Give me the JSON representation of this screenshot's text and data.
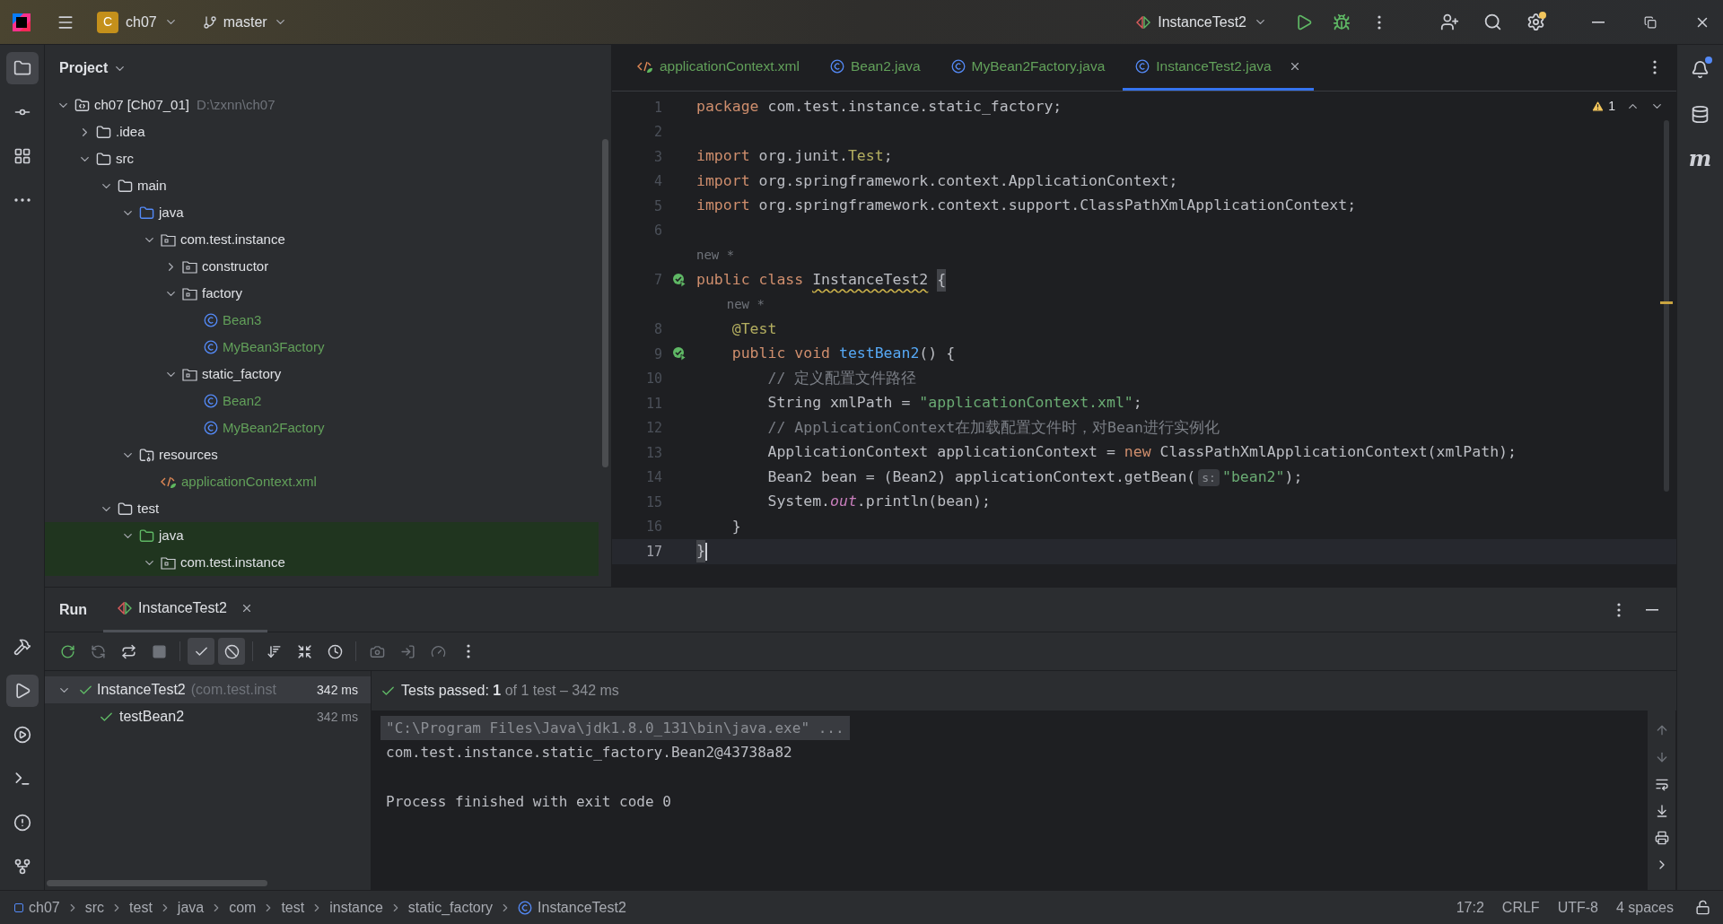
{
  "title_bar": {
    "project_badge": "C",
    "project": "ch07",
    "branch": "master",
    "run_config": "InstanceTest2",
    "settings_badge": true
  },
  "left_toolbar": {
    "top": [
      {
        "kind": "project",
        "selected": true
      },
      {
        "kind": "commit",
        "selected": false
      },
      {
        "kind": "structure",
        "selected": false
      },
      {
        "kind": "more",
        "selected": false
      }
    ],
    "bottom": [
      {
        "kind": "build",
        "selected": false
      },
      {
        "kind": "run",
        "selected": true
      },
      {
        "kind": "services",
        "selected": false
      },
      {
        "kind": "terminal",
        "selected": false
      },
      {
        "kind": "problems",
        "selected": false
      },
      {
        "kind": "git",
        "selected": false
      }
    ]
  },
  "right_toolbar": [
    {
      "kind": "notifications",
      "badge": true
    },
    {
      "kind": "database",
      "badge": false
    },
    {
      "kind": "maven",
      "label": "m",
      "badge": false
    }
  ],
  "project": {
    "title": "Project",
    "tree": [
      {
        "label": "ch07 [Ch07_01]",
        "path": "D:\\zxnn\\ch07",
        "kind": "module",
        "expanded": true,
        "test_scope": false,
        "children": [
          {
            "label": ".idea",
            "kind": "folder",
            "expanded": false,
            "test_scope": false
          },
          {
            "label": "src",
            "kind": "folder",
            "expanded": true,
            "test_scope": false,
            "children": [
              {
                "label": "main",
                "kind": "folder",
                "expanded": true,
                "test_scope": false,
                "children": [
                  {
                    "label": "java",
                    "kind": "source_root",
                    "expanded": true,
                    "test_scope": false,
                    "children": [
                      {
                        "label": "com.test.instance",
                        "kind": "package",
                        "expanded": true,
                        "test_scope": false,
                        "children": [
                          {
                            "label": "constructor",
                            "kind": "package",
                            "expanded": false,
                            "test_scope": false
                          },
                          {
                            "label": "factory",
                            "kind": "package",
                            "expanded": true,
                            "test_scope": false,
                            "children": [
                              {
                                "label": "Bean3",
                                "kind": "class",
                                "test_scope": false
                              },
                              {
                                "label": "MyBean3Factory",
                                "kind": "class",
                                "test_scope": false
                              }
                            ]
                          },
                          {
                            "label": "static_factory",
                            "kind": "package",
                            "expanded": true,
                            "test_scope": false,
                            "children": [
                              {
                                "label": "Bean2",
                                "kind": "class",
                                "test_scope": false
                              },
                              {
                                "label": "MyBean2Factory",
                                "kind": "class",
                                "test_scope": false
                              }
                            ]
                          }
                        ]
                      }
                    ]
                  },
                  {
                    "label": "resources",
                    "kind": "resources",
                    "expanded": true,
                    "test_scope": false,
                    "children": [
                      {
                        "label": "applicationContext.xml",
                        "kind": "xml",
                        "test_scope": false
                      }
                    ]
                  }
                ]
              },
              {
                "label": "test",
                "kind": "folder",
                "expanded": true,
                "test_scope": false,
                "children": [
                  {
                    "label": "java",
                    "kind": "test_root",
                    "expanded": true,
                    "test_scope": true,
                    "children": [
                      {
                        "label": "com.test.instance",
                        "kind": "package",
                        "expanded": true,
                        "test_scope": true
                      }
                    ]
                  }
                ]
              }
            ]
          }
        ]
      }
    ]
  },
  "editor": {
    "tabs": [
      {
        "label": "applicationContext.xml",
        "kind": "xml",
        "selected": false,
        "closable": false
      },
      {
        "label": "Bean2.java",
        "kind": "class",
        "selected": false,
        "closable": false
      },
      {
        "label": "MyBean2Factory.java",
        "kind": "class",
        "selected": false,
        "closable": false
      },
      {
        "label": "InstanceTest2.java",
        "kind": "class",
        "selected": true,
        "closable": true
      }
    ],
    "warnings": "1",
    "lines": [
      {
        "kind": "code",
        "number": "1",
        "tokens": [
          {
            "kind": "keyword",
            "text": "package"
          },
          {
            "kind": "plain",
            "text": " com.test.instance.static_factory;"
          }
        ]
      },
      {
        "kind": "code",
        "number": "2"
      },
      {
        "kind": "code",
        "number": "3",
        "tokens": [
          {
            "kind": "keyword",
            "text": "import"
          },
          {
            "kind": "plain",
            "text": " org.junit."
          },
          {
            "kind": "annotation",
            "text": "Test"
          },
          {
            "kind": "plain",
            "text": ";"
          }
        ]
      },
      {
        "kind": "code",
        "number": "4",
        "tokens": [
          {
            "kind": "keyword",
            "text": "import"
          },
          {
            "kind": "plain",
            "text": " org.springframework.context.ApplicationContext;"
          }
        ]
      },
      {
        "kind": "code",
        "number": "5",
        "tokens": [
          {
            "kind": "keyword",
            "text": "import"
          },
          {
            "kind": "plain",
            "text": " org.springframework.context.support.ClassPathXmlApplicationContext;"
          }
        ]
      },
      {
        "kind": "code",
        "number": "6"
      },
      {
        "kind": "hint",
        "text": "new *"
      },
      {
        "kind": "code",
        "number": "7",
        "runnable": true,
        "tokens": [
          {
            "kind": "keyword",
            "text": "public class "
          },
          {
            "kind": "warn",
            "text": "InstanceTest2"
          },
          {
            "kind": "brace",
            "text": "{"
          }
        ]
      },
      {
        "kind": "hint",
        "text": "    new *"
      },
      {
        "kind": "code",
        "number": "8",
        "tokens": [
          {
            "kind": "annotation",
            "text": "    @Test"
          }
        ]
      },
      {
        "kind": "code",
        "number": "9",
        "runnable": true,
        "tokens": [
          {
            "kind": "keyword",
            "text": "    public void "
          },
          {
            "kind": "method",
            "text": "testBean2"
          },
          {
            "kind": "plain",
            "text": "() {"
          }
        ]
      },
      {
        "kind": "code",
        "number": "10",
        "tokens": [
          {
            "kind": "comment",
            "text": "        // 定义配置文件路径"
          }
        ]
      },
      {
        "kind": "code",
        "number": "11",
        "tokens": [
          {
            "kind": "plain",
            "text": "        String xmlPath = "
          },
          {
            "kind": "string",
            "text": "\"applicationContext.xml\""
          },
          {
            "kind": "plain",
            "text": ";"
          }
        ]
      },
      {
        "kind": "code",
        "number": "12",
        "tokens": [
          {
            "kind": "comment",
            "text": "        // ApplicationContext在加载配置文件时，对Bean进行实例化"
          }
        ]
      },
      {
        "kind": "code",
        "number": "13",
        "tokens": [
          {
            "kind": "plain",
            "text": "        ApplicationContext applicationContext = "
          },
          {
            "kind": "keyword",
            "text": "new"
          },
          {
            "kind": "plain",
            "text": " ClassPathXmlApplicationContext(xmlPath);"
          }
        ]
      },
      {
        "kind": "code",
        "number": "14",
        "tokens": [
          {
            "kind": "plain",
            "text": "        Bean2 bean = (Bean2) applicationContext.getBean("
          },
          {
            "kind": "inlay",
            "text": "s:"
          },
          {
            "kind": "string",
            "text": "\"bean2\""
          },
          {
            "kind": "plain",
            "text": ");"
          }
        ]
      },
      {
        "kind": "code",
        "number": "15",
        "tokens": [
          {
            "kind": "plain",
            "text": "        System."
          },
          {
            "kind": "static",
            "text": "out"
          },
          {
            "kind": "plain",
            "text": ".println(bean);"
          }
        ]
      },
      {
        "kind": "code",
        "number": "16",
        "tokens": [
          {
            "kind": "plain",
            "text": "    }"
          }
        ]
      },
      {
        "kind": "code",
        "number": "17",
        "current": true,
        "tokens": [
          {
            "kind": "brace",
            "text": "}"
          }
        ]
      }
    ]
  },
  "run": {
    "title": "Run",
    "tab": {
      "label": "InstanceTest2",
      "selected": true
    },
    "toolbar": [
      {
        "kind": "rerun",
        "enabled": true
      },
      {
        "kind": "rerun_failed",
        "enabled": false
      },
      {
        "kind": "toggle_auto",
        "enabled": true
      },
      {
        "kind": "stop",
        "enabled": false
      },
      {
        "kind": "show_passed",
        "enabled": true,
        "on": true
      },
      {
        "kind": "show_ignored",
        "enabled": true,
        "on": true
      },
      {
        "kind": "sort",
        "enabled": true
      },
      {
        "kind": "collapse",
        "enabled": true
      },
      {
        "kind": "history",
        "enabled": true
      },
      {
        "kind": "snapshot",
        "enabled": false
      },
      {
        "kind": "import",
        "enabled": false
      },
      {
        "kind": "coverage",
        "enabled": false
      },
      {
        "kind": "more",
        "enabled": true
      }
    ],
    "tests": [
      {
        "name": "InstanceTest2",
        "detail": "(com.test.inst",
        "time": "342 ms",
        "passed": true,
        "expanded": true,
        "selected": true,
        "children": [
          {
            "name": "testBean2",
            "time": "342 ms",
            "passed": true,
            "selected": false
          }
        ]
      }
    ],
    "summary": {
      "label": "Tests passed:",
      "count": "1",
      "rest": "of 1 test – 342 ms"
    },
    "console": [
      {
        "kind": "command",
        "text": "\"C:\\Program Files\\Java\\jdk1.8.0_131\\bin\\java.exe\" ...",
        "gap_before": false
      },
      {
        "kind": "output",
        "text": "com.test.instance.static_factory.Bean2@43738a82",
        "gap_before": false
      },
      {
        "kind": "output",
        "text": "Process finished with exit code 0",
        "gap_before": true
      }
    ]
  },
  "breadcrumbs": [
    {
      "label": "ch07",
      "kind": "module"
    },
    {
      "label": "src",
      "kind": "plain"
    },
    {
      "label": "test",
      "kind": "plain"
    },
    {
      "label": "java",
      "kind": "plain"
    },
    {
      "label": "com",
      "kind": "plain"
    },
    {
      "label": "test",
      "kind": "plain"
    },
    {
      "label": "instance",
      "kind": "plain"
    },
    {
      "label": "static_factory",
      "kind": "plain"
    },
    {
      "label": "InstanceTest2",
      "kind": "class"
    }
  ],
  "status": [
    "17:2",
    "CRLF",
    "UTF-8",
    "4 spaces"
  ]
}
